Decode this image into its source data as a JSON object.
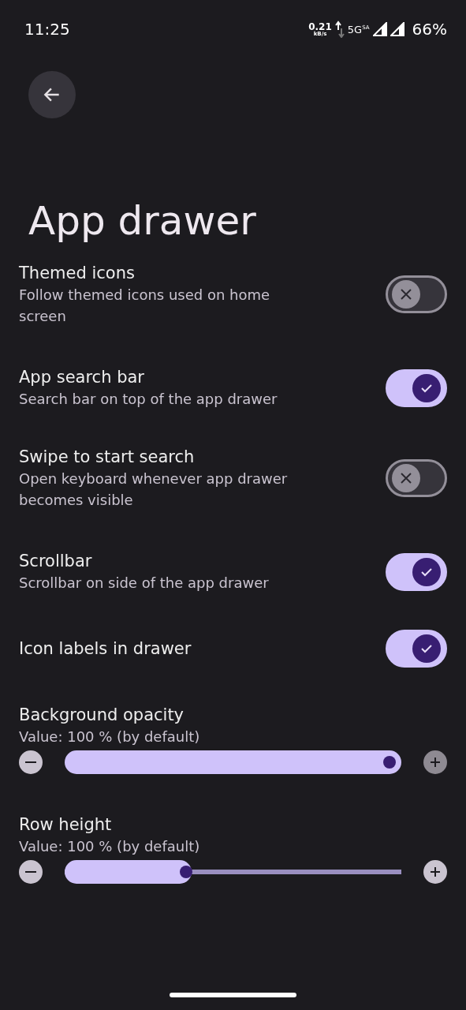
{
  "status_bar": {
    "time": "11:25",
    "speed": "0.21",
    "speed_unit": "kB/s",
    "network": "5G",
    "network_sup": "SA",
    "battery": "66%"
  },
  "title": "App drawer",
  "settings": [
    {
      "kind": "switch",
      "title": "Themed icons",
      "subtitle": "Follow themed icons used on home screen",
      "on": false
    },
    {
      "kind": "switch",
      "title": "App search bar",
      "subtitle": "Search bar on top of the app drawer",
      "on": true
    },
    {
      "kind": "switch",
      "title": "Swipe to start search",
      "subtitle": "Open keyboard whenever app drawer becomes visible",
      "on": false
    },
    {
      "kind": "switch",
      "title": "Scrollbar",
      "subtitle": "Scrollbar on side of the app drawer",
      "on": true
    },
    {
      "kind": "switch",
      "title": "Icon labels in drawer",
      "on": true
    },
    {
      "kind": "slider",
      "title": "Background opacity",
      "subtitle": "Value: 100 % (by default)",
      "level": 1,
      "minus_disabled": false,
      "plus_disabled": true
    },
    {
      "kind": "slider",
      "title": "Row height",
      "subtitle": "Value: 100 % (by default)",
      "level": 0.35,
      "minus_disabled": false,
      "plus_disabled": false
    }
  ]
}
